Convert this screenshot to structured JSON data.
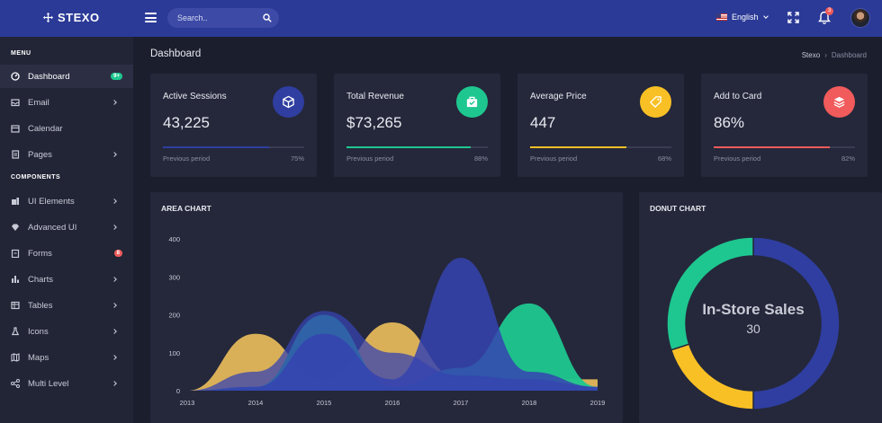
{
  "topbar": {
    "brand": "STEXO",
    "search_placeholder": "Search..",
    "language": "English",
    "notification_count": "3"
  },
  "sidebar": {
    "menu_title": "MENU",
    "components_title": "COMPONENTS",
    "items": [
      {
        "label": "Dashboard",
        "icon": "dashboard-icon",
        "badge": "9+"
      },
      {
        "label": "Email",
        "icon": "inbox-icon"
      },
      {
        "label": "Calendar",
        "icon": "calendar-icon"
      },
      {
        "label": "Pages",
        "icon": "pages-icon"
      },
      {
        "label": "UI Elements",
        "icon": "ui-elements-icon"
      },
      {
        "label": "Advanced UI",
        "icon": "diamond-icon"
      },
      {
        "label": "Forms",
        "icon": "clipboard-icon",
        "badge": "8"
      },
      {
        "label": "Charts",
        "icon": "bar-chart-icon"
      },
      {
        "label": "Tables",
        "icon": "table-icon"
      },
      {
        "label": "Icons",
        "icon": "flask-icon"
      },
      {
        "label": "Maps",
        "icon": "map-icon"
      },
      {
        "label": "Multi Level",
        "icon": "share-icon"
      }
    ]
  },
  "page": {
    "title": "Dashboard",
    "breadcrumb": [
      "Stexo",
      "Dashboard"
    ]
  },
  "cards": [
    {
      "title": "Active Sessions",
      "value": "43,225",
      "footer_label": "Previous period",
      "percent": "75%",
      "progress": 0.75,
      "color": "#2f3ea0",
      "icon": "cube-icon"
    },
    {
      "title": "Total Revenue",
      "value": "$73,265",
      "footer_label": "Previous period",
      "percent": "88%",
      "progress": 0.88,
      "color": "#1ec78f",
      "icon": "briefcase-icon"
    },
    {
      "title": "Average Price",
      "value": "447",
      "footer_label": "Previous period",
      "percent": "68%",
      "progress": 0.68,
      "color": "#f9c025",
      "icon": "tag-icon"
    },
    {
      "title": "Add to Card",
      "value": "86%",
      "footer_label": "Previous period",
      "percent": "82%",
      "progress": 0.82,
      "color": "#f15b5b",
      "icon": "layers-icon"
    }
  ],
  "area_chart": {
    "title": "AREA CHART"
  },
  "donut_chart": {
    "title": "DONUT CHART",
    "center_label": "In-Store Sales",
    "center_value": "30"
  },
  "chart_data": [
    {
      "type": "area",
      "title": "AREA CHART",
      "x": [
        2013,
        2014,
        2015,
        2016,
        2017,
        2018,
        2019
      ],
      "ylim": [
        0,
        400
      ],
      "yticks": [
        0,
        100,
        200,
        300,
        400
      ],
      "grid": false,
      "series": [
        {
          "values": [
            0,
            150,
            30,
            180,
            30,
            30,
            30
          ],
          "color": "#e3b75a"
        },
        {
          "values": [
            0,
            10,
            200,
            10,
            60,
            230,
            10
          ],
          "color": "#1ec78f"
        },
        {
          "values": [
            0,
            10,
            150,
            30,
            350,
            50,
            10
          ],
          "color": "#3543b0"
        },
        {
          "values": [
            0,
            50,
            210,
            100,
            40,
            30,
            10
          ],
          "color": "#3543b0"
        }
      ]
    },
    {
      "type": "pie",
      "title": "DONUT CHART",
      "center_label": "In-Store Sales",
      "center_value": 30,
      "values": [
        50,
        20,
        30
      ],
      "colors": [
        "#2f3ea0",
        "#f9c025",
        "#1ec78f"
      ]
    }
  ]
}
